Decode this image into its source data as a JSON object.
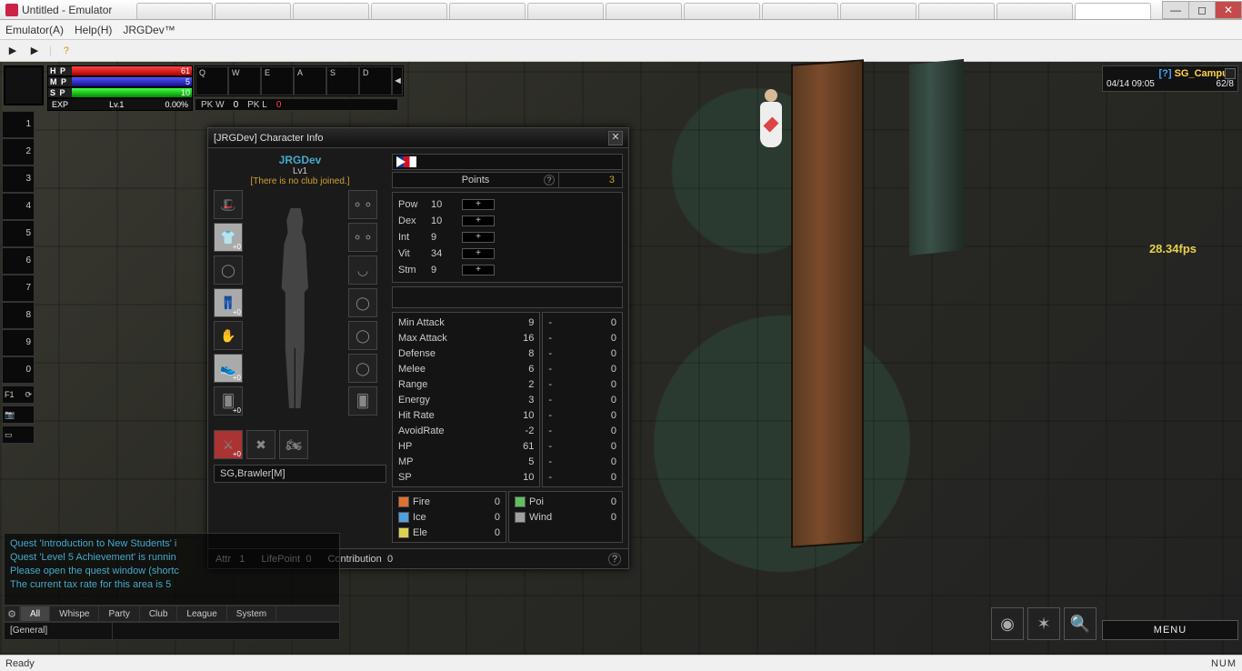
{
  "os": {
    "title": "Untitled - Emulator",
    "min": "—",
    "max": "◻",
    "close": "✕"
  },
  "menu": {
    "emulator": "Emulator(A)",
    "help": "Help(H)",
    "jrg": "JRGDev™"
  },
  "toolbar": {
    "play1": "▶",
    "play2": "▶",
    "help": "?"
  },
  "hud": {
    "hp_label": "H P",
    "hp_val": "61",
    "mp_label": "M P",
    "mp_val": "5",
    "sp_label": "S P",
    "sp_val": "10",
    "exp_label": "EXP",
    "lv": "Lv.1",
    "exp_pct": "0.00%"
  },
  "skills": {
    "keys": [
      "Q",
      "W",
      "E",
      "A",
      "S",
      "D"
    ],
    "arrow": "◄"
  },
  "pk": {
    "w_label": "PK W",
    "w_val": "0",
    "l_label": "PK L",
    "l_val": "0"
  },
  "numslots": [
    "1",
    "2",
    "3",
    "4",
    "5",
    "6",
    "7",
    "8",
    "9",
    "0"
  ],
  "misc": {
    "f1": "F1"
  },
  "loc": {
    "q": "[?]",
    "name": "SG_Campus",
    "dt": "04/14 09:05",
    "count": "62/8"
  },
  "fps": "28.34fps",
  "chat": {
    "lines": [
      "Quest 'Introduction to New Students' i",
      "Quest 'Level 5 Achievement' is runnin",
      "Please open the quest window (shortc",
      "The current tax rate for this area is 5"
    ],
    "tabs": [
      "All",
      "Whispe",
      "Party",
      "Club",
      "League",
      "System"
    ],
    "channel": "[General]"
  },
  "menu_btn": "MENU",
  "status": {
    "ready": "Ready",
    "num": "NUM"
  },
  "panel": {
    "title": "[JRGDev] Character Info",
    "close": "✕",
    "name": "JRGDev",
    "lv": "Lv1",
    "club": "[There is no club joined.]",
    "class": "SG,Brawler[M]",
    "points_label": "Points",
    "points_val": "3",
    "stats": [
      {
        "nm": "Pow",
        "vl": "10"
      },
      {
        "nm": "Dex",
        "vl": "10"
      },
      {
        "nm": "Int",
        "vl": "9"
      },
      {
        "nm": "Vit",
        "vl": "34"
      },
      {
        "nm": "Stm",
        "vl": "9"
      }
    ],
    "plus": "+",
    "combat": [
      {
        "lbl": "Min Attack",
        "val": "9"
      },
      {
        "lbl": "Max Attack",
        "val": "16"
      },
      {
        "lbl": "Defense",
        "val": "8"
      },
      {
        "lbl": "Melee",
        "val": "6"
      },
      {
        "lbl": "Range",
        "val": "2"
      },
      {
        "lbl": "Energy",
        "val": "3"
      },
      {
        "lbl": "Hit Rate",
        "val": "10"
      },
      {
        "lbl": "AvoidRate",
        "val": "-2"
      },
      {
        "lbl": "HP",
        "val": "61"
      },
      {
        "lbl": "MP",
        "val": "5"
      },
      {
        "lbl": "SP",
        "val": "10"
      }
    ],
    "combat2": [
      {
        "lbl": "-",
        "val": "0"
      },
      {
        "lbl": "-",
        "val": "0"
      },
      {
        "lbl": "-",
        "val": "0"
      },
      {
        "lbl": "-",
        "val": "0"
      },
      {
        "lbl": "-",
        "val": "0"
      },
      {
        "lbl": "-",
        "val": "0"
      },
      {
        "lbl": "-",
        "val": "0"
      },
      {
        "lbl": "-",
        "val": "0"
      },
      {
        "lbl": "-",
        "val": "0"
      },
      {
        "lbl": "-",
        "val": "0"
      },
      {
        "lbl": "-",
        "val": "0"
      }
    ],
    "elems1": [
      {
        "nm": "Fire",
        "c": "#e07030",
        "val": "0"
      },
      {
        "nm": "Ice",
        "c": "#50a0e0",
        "val": "0"
      },
      {
        "nm": "Ele",
        "c": "#e0d050",
        "val": "0"
      }
    ],
    "elems2": [
      {
        "nm": "Poi",
        "c": "#60c060",
        "val": "0"
      },
      {
        "nm": "Wind",
        "c": "#a0a0a0",
        "val": "0"
      }
    ],
    "footer": {
      "attr_lbl": "Attr",
      "attr_val": "1",
      "lp_lbl": "LifePoint",
      "lp_val": "0",
      "con_lbl": "Contribution",
      "con_val": "0"
    }
  }
}
